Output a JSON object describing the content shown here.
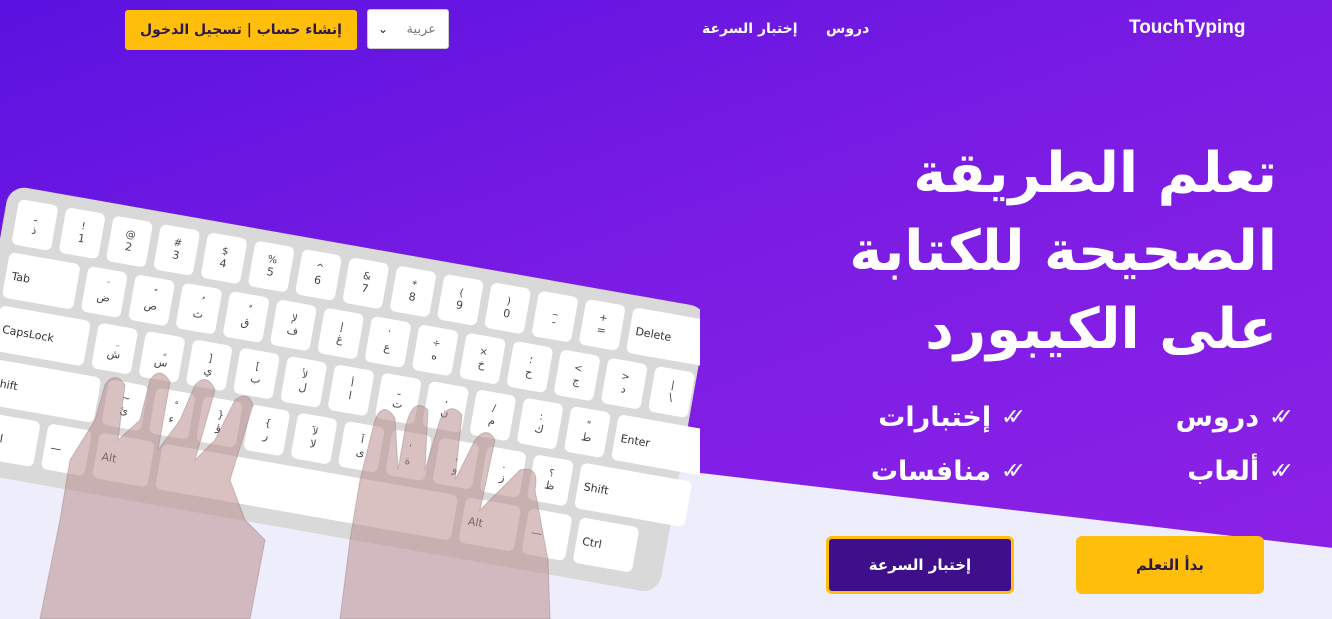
{
  "nav": {
    "brand": "TouchTyping",
    "lessons": "دروس",
    "speed_test": "إختبار السرعة",
    "language": "عربية",
    "auth": "إنشاء حساب | تسجيل الدخول"
  },
  "hero": {
    "headline": [
      "تعلم الطريقة",
      "الصحيحة للكتابة",
      "على الكيبورد"
    ],
    "features": [
      "دروس",
      "إختبارات",
      "ألعاب",
      "منافسات"
    ],
    "start_button": "بدأ التعلم",
    "test_button": "إختبار السرعة"
  },
  "keyboard": {
    "rows": [
      [
        [
          "ـ",
          "ذ"
        ],
        [
          "!",
          "1"
        ],
        [
          "@",
          "2"
        ],
        [
          "#",
          "3"
        ],
        [
          "$",
          "4"
        ],
        [
          "%",
          "5"
        ],
        [
          "^",
          "6"
        ],
        [
          "&",
          "7"
        ],
        [
          "*",
          "8"
        ],
        [
          "(",
          "9"
        ],
        [
          ")",
          "0"
        ],
        [
          "_",
          "-"
        ],
        [
          "+",
          "="
        ],
        [
          "",
          "Delete"
        ]
      ],
      [
        [
          "",
          "Tab"
        ],
        [
          "َ",
          "ض"
        ],
        [
          "ً",
          "ص"
        ],
        [
          "ُ",
          "ث"
        ],
        [
          "ٌ",
          "ق"
        ],
        [
          "لإ",
          "ف"
        ],
        [
          "إ",
          "غ"
        ],
        [
          "`",
          "ع"
        ],
        [
          "÷",
          "ه"
        ],
        [
          "×",
          "خ"
        ],
        [
          "؛",
          "ح"
        ],
        [
          "<",
          "ج"
        ],
        [
          ">",
          "د"
        ],
        [
          "|",
          "\\"
        ]
      ],
      [
        [
          "",
          "CapsLock"
        ],
        [
          "ِ",
          "ش"
        ],
        [
          "ٍ",
          "س"
        ],
        [
          "]",
          "ي"
        ],
        [
          "[",
          "ب"
        ],
        [
          "لأ",
          "ل"
        ],
        [
          "أ",
          "ا"
        ],
        [
          "ـ",
          "ت"
        ],
        [
          "،",
          "ن"
        ],
        [
          "/",
          "م"
        ],
        [
          ":",
          "ك"
        ],
        [
          "\"",
          "ط"
        ],
        [
          "",
          "Enter"
        ]
      ],
      [
        [
          "",
          "Shift"
        ],
        [
          "~",
          "ئ"
        ],
        [
          "ْ",
          "ء"
        ],
        [
          "}",
          "ؤ"
        ],
        [
          "{",
          "ر"
        ],
        [
          "لآ",
          "لا"
        ],
        [
          "آ",
          "ى"
        ],
        [
          "'",
          "ة"
        ],
        [
          ",",
          "و"
        ],
        [
          ".",
          "ز"
        ],
        [
          "؟",
          "ظ"
        ],
        [
          "",
          "Shift"
        ]
      ],
      [
        [
          "",
          "Ctrl"
        ],
        [
          "",
          "—"
        ],
        [
          "",
          "Alt"
        ],
        [
          "",
          ""
        ],
        [
          "",
          "Alt"
        ],
        [
          "",
          "—"
        ],
        [
          "",
          "Ctrl"
        ]
      ]
    ]
  },
  "colors": {
    "accent": "#ffbe0b",
    "primary": "#5b12e0",
    "dark_button": "#3d0f8a"
  }
}
